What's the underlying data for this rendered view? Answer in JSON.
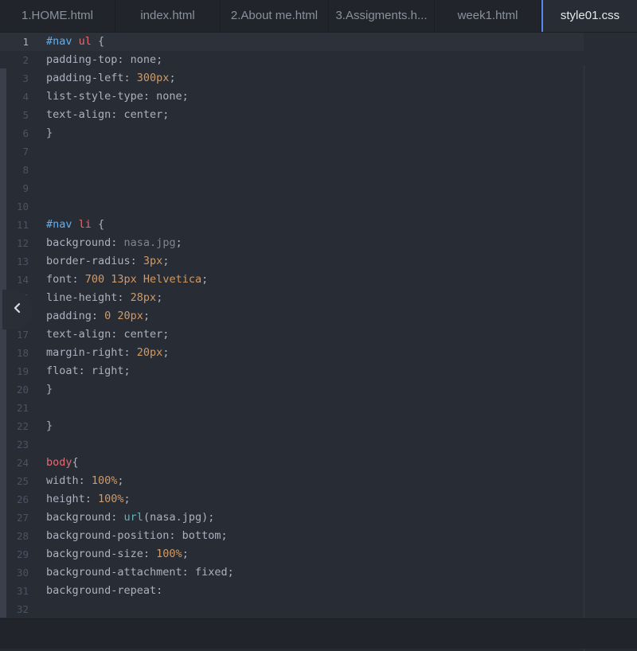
{
  "tabs": [
    {
      "label": "1.HOME.html",
      "active": false
    },
    {
      "label": "index.html",
      "active": false
    },
    {
      "label": "2.About me.html",
      "active": false
    },
    {
      "label": "3.Assigments.h...",
      "active": false
    },
    {
      "label": "week1.html",
      "active": false
    },
    {
      "label": "style01.css",
      "active": true
    }
  ],
  "editor": {
    "active_line": 1,
    "lines": [
      [
        {
          "t": "#nav",
          "c": "sel"
        },
        {
          "t": " "
        },
        {
          "t": "ul",
          "c": "tag"
        },
        {
          "t": " {"
        }
      ],
      [
        {
          "t": "padding-top: none;"
        }
      ],
      [
        {
          "t": "padding-left: "
        },
        {
          "t": "300px",
          "c": "num"
        },
        {
          "t": ";"
        }
      ],
      [
        {
          "t": "list-style-type: none;"
        }
      ],
      [
        {
          "t": "text-align: center;"
        }
      ],
      [
        {
          "t": "}"
        }
      ],
      [],
      [],
      [],
      [],
      [
        {
          "t": "#nav",
          "c": "sel"
        },
        {
          "t": " "
        },
        {
          "t": "li",
          "c": "tag"
        },
        {
          "t": " {"
        }
      ],
      [
        {
          "t": "background: "
        },
        {
          "t": "nasa.jpg",
          "c": "str"
        },
        {
          "t": ";"
        }
      ],
      [
        {
          "t": "border-radius: "
        },
        {
          "t": "3px",
          "c": "num"
        },
        {
          "t": ";"
        }
      ],
      [
        {
          "t": "font: "
        },
        {
          "t": "700 13px Helvetica",
          "c": "num"
        },
        {
          "t": ";"
        }
      ],
      [
        {
          "t": "line-height: "
        },
        {
          "t": "28px",
          "c": "num"
        },
        {
          "t": ";"
        }
      ],
      [
        {
          "t": "padding: "
        },
        {
          "t": "0 20px",
          "c": "num"
        },
        {
          "t": ";"
        }
      ],
      [
        {
          "t": "text-align: center;"
        }
      ],
      [
        {
          "t": "margin-right: "
        },
        {
          "t": "20px",
          "c": "num"
        },
        {
          "t": ";"
        }
      ],
      [
        {
          "t": "float: right;"
        }
      ],
      [
        {
          "t": "}"
        }
      ],
      [],
      [
        {
          "t": "}"
        }
      ],
      [],
      [
        {
          "t": "body",
          "c": "tag"
        },
        {
          "t": "{"
        }
      ],
      [
        {
          "t": "width: "
        },
        {
          "t": "100%",
          "c": "num"
        },
        {
          "t": ";"
        }
      ],
      [
        {
          "t": "height: "
        },
        {
          "t": "100%",
          "c": "num"
        },
        {
          "t": ";"
        }
      ],
      [
        {
          "t": "background: "
        },
        {
          "t": "url",
          "c": "fn"
        },
        {
          "t": "(nasa.jpg);"
        }
      ],
      [
        {
          "t": "background-position: bottom;"
        }
      ],
      [
        {
          "t": "background-size: "
        },
        {
          "t": "100%",
          "c": "num"
        },
        {
          "t": ";"
        }
      ],
      [
        {
          "t": "background-attachment: fixed;"
        }
      ],
      [
        {
          "t": "background-repeat:"
        }
      ],
      []
    ]
  },
  "icons": {
    "collapse": "chevron-left-icon"
  }
}
